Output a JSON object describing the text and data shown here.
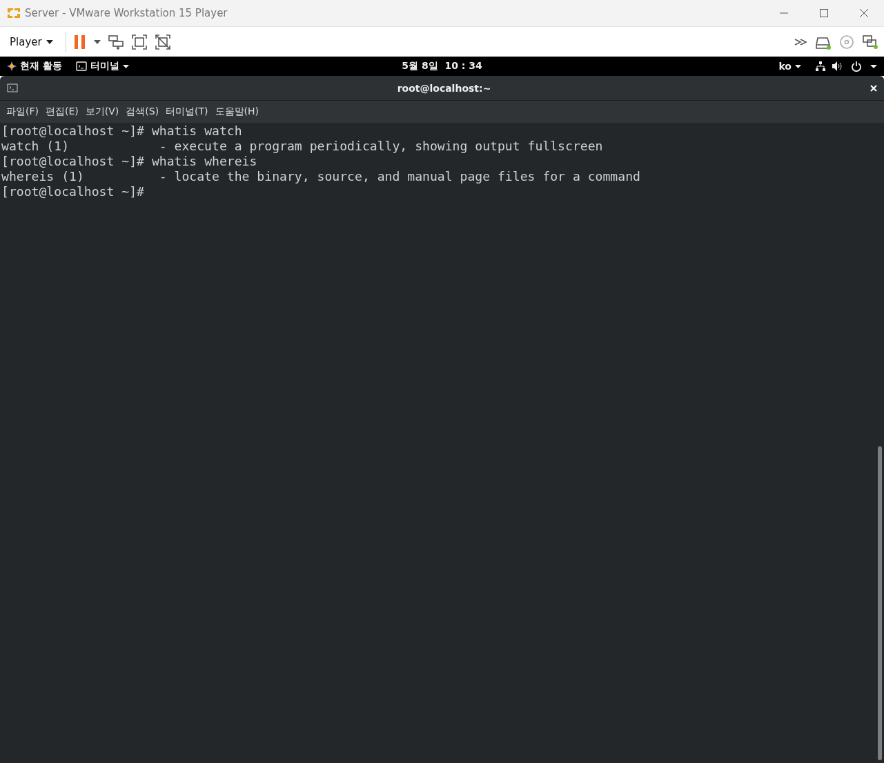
{
  "window": {
    "title": "Server - VMware Workstation 15 Player"
  },
  "toolbar": {
    "player_menu": "Player"
  },
  "top_bar": {
    "activities": "현재 활동",
    "app_menu": "터미널",
    "clock": "5월 8일  10 : 34",
    "input_method": "ko"
  },
  "terminal": {
    "title": "root@localhost:~",
    "menu": [
      "파일(F)",
      "편집(E)",
      "보기(V)",
      "검색(S)",
      "터미널(T)",
      "도움말(H)"
    ],
    "lines": [
      {
        "kind": "command",
        "prompt": "[root@localhost ~]#",
        "text": "whatis watch"
      },
      {
        "kind": "output",
        "text": "watch (1)            - execute a program periodically, showing output fullscreen"
      },
      {
        "kind": "command",
        "prompt": "[root@localhost ~]#",
        "text": "whatis whereis"
      },
      {
        "kind": "output",
        "text": "whereis (1)          - locate the binary, source, and manual page files for a command"
      },
      {
        "kind": "command",
        "prompt": "[root@localhost ~]#"
      }
    ]
  }
}
